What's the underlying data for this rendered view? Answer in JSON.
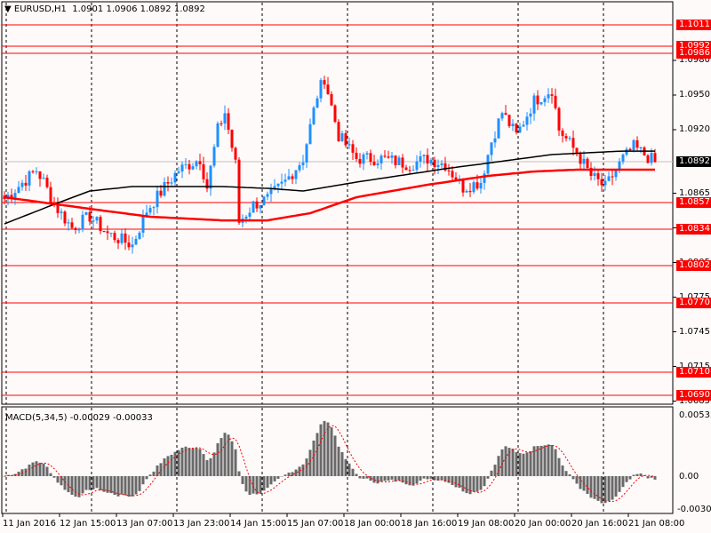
{
  "header": {
    "symbol": "EURUSD,H1",
    "open": "1.0901",
    "high": "1.0906",
    "low": "1.0892",
    "close": "1.0892"
  },
  "macd": {
    "label": "MACD(5,34,5)",
    "main": "-0.00029",
    "signal": "-0.00033",
    "scale_top": "0.00533",
    "scale_zero": "0.00",
    "scale_bottom": "-0.00307"
  },
  "colors": {
    "bg": "#fffafa",
    "bull": "#1e90ff",
    "bear": "#ff0000",
    "level": "#ff0000",
    "ma_fast": "#000000",
    "ma_slow": "#ff0000",
    "macd_hist": "#696969"
  },
  "price_ticks": [
    "1.0980",
    "1.0950",
    "1.0920",
    "1.0865",
    "1.0835",
    "1.0805",
    "1.0775",
    "1.0745",
    "1.0715",
    "1.0685"
  ],
  "levels": [
    "1.1011",
    "1.0992",
    "1.0986",
    "1.0857",
    "1.0834",
    "1.0802",
    "1.0770",
    "1.0710",
    "1.0690"
  ],
  "bid": "1.0892",
  "time_labels": [
    "11 Jan 2016",
    "12 Jan 15:00",
    "13 Jan 07:00",
    "13 Jan 23:00",
    "14 Jan 15:00",
    "15 Jan 07:00",
    "18 Jan 00:00",
    "18 Jan 16:00",
    "19 Jan 08:00",
    "20 Jan 00:00",
    "20 Jan 16:00",
    "21 Jan 08:00"
  ],
  "chart_data": {
    "type": "candlestick",
    "symbol": "EURUSD",
    "timeframe": "H1",
    "price_range": [
      1.0683,
      1.1028
    ],
    "close_keypoints": [
      [
        0,
        1.086
      ],
      [
        9,
        1.0885
      ],
      [
        11,
        1.0875
      ],
      [
        14,
        1.0855
      ],
      [
        19,
        1.0835
      ],
      [
        24,
        1.0845
      ],
      [
        29,
        1.083
      ],
      [
        36,
        1.082
      ],
      [
        40,
        1.085
      ],
      [
        45,
        1.087
      ],
      [
        49,
        1.0885
      ],
      [
        55,
        1.0895
      ],
      [
        57,
        1.087
      ],
      [
        60,
        1.092
      ],
      [
        62,
        1.0935
      ],
      [
        65,
        1.089
      ],
      [
        66,
        1.084
      ],
      [
        70,
        1.0855
      ],
      [
        74,
        1.086
      ],
      [
        79,
        1.0875
      ],
      [
        84,
        1.0895
      ],
      [
        88,
        1.095
      ],
      [
        90,
        1.0965
      ],
      [
        94,
        1.0915
      ],
      [
        99,
        1.0895
      ],
      [
        106,
        1.0895
      ],
      [
        114,
        1.089
      ],
      [
        119,
        1.0895
      ],
      [
        124,
        1.089
      ],
      [
        129,
        1.087
      ],
      [
        134,
        1.0875
      ],
      [
        137,
        1.091
      ],
      [
        140,
        1.0935
      ],
      [
        144,
        1.0915
      ],
      [
        149,
        1.0945
      ],
      [
        154,
        1.0955
      ],
      [
        156,
        1.092
      ],
      [
        161,
        1.09
      ],
      [
        165,
        1.088
      ],
      [
        169,
        1.087
      ],
      [
        174,
        1.0895
      ],
      [
        177,
        1.0905
      ],
      [
        183,
        1.0892
      ]
    ],
    "ma_fast_keypoints": [
      [
        0,
        1.08385
      ],
      [
        14,
        1.08554
      ],
      [
        24,
        1.08669
      ],
      [
        36,
        1.08708
      ],
      [
        49,
        1.08708
      ],
      [
        61,
        1.08708
      ],
      [
        74,
        1.08692
      ],
      [
        84,
        1.08669
      ],
      [
        99,
        1.08746
      ],
      [
        124,
        1.08862
      ],
      [
        139,
        1.08923
      ],
      [
        154,
        1.08985
      ],
      [
        174,
        1.09015
      ],
      [
        183,
        1.09015
      ]
    ],
    "ma_slow_keypoints": [
      [
        0,
        1.08615
      ],
      [
        24,
        1.08515
      ],
      [
        41,
        1.08446
      ],
      [
        61,
        1.08415
      ],
      [
        74,
        1.08415
      ],
      [
        86,
        1.08477
      ],
      [
        99,
        1.08615
      ],
      [
        119,
        1.08723
      ],
      [
        136,
        1.088
      ],
      [
        149,
        1.08838
      ],
      [
        161,
        1.08854
      ],
      [
        183,
        1.08854
      ]
    ],
    "macd": {
      "fast": 5,
      "slow": 34,
      "signal": 5,
      "range": [
        -0.00307,
        0.00533
      ]
    }
  }
}
